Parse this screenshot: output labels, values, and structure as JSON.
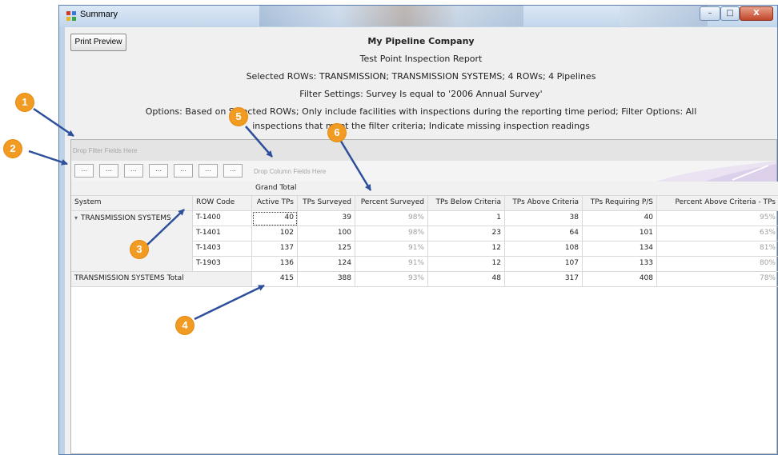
{
  "window": {
    "title": "Summary"
  },
  "controls": {
    "minimize": "–",
    "maximize": "□",
    "close": "X"
  },
  "toolbar": {
    "print_preview": "Print Preview"
  },
  "report": {
    "company": "My Pipeline Company",
    "title": "Test Point Inspection Report",
    "selected": "Selected ROWs: TRANSMISSION; TRANSMISSION SYSTEMS; 4 ROWs; 4 Pipelines",
    "filter": "Filter Settings: Survey Is equal to '2006 Annual Survey'",
    "options_line1": "Options: Based on Selected ROWs; Only include facilities with inspections during the reporting time period; Filter Options: All",
    "options_line2": "inspections that meet the filter criteria; Indicate missing inspection readings"
  },
  "pivot": {
    "filter_drop": "Drop Filter Fields Here",
    "column_drop": "Drop Column Fields Here",
    "field_buttons": [
      "...",
      "...",
      "...",
      "...",
      "...",
      "...",
      "..."
    ],
    "grand_total": "Grand Total",
    "row_headers": [
      "System",
      "ROW Code"
    ],
    "columns": [
      "Active TPs",
      "TPs Surveyed",
      "Percent Surveyed",
      "TPs Below Criteria",
      "TPs Above Criteria",
      "TPs Requiring P/S",
      "Percent Above Criteria - TPs"
    ],
    "system": "TRANSMISSION SYSTEMS",
    "system_expander": "▾",
    "rows": [
      {
        "code": "T-1400",
        "values": [
          "40",
          "39",
          "98%",
          "1",
          "38",
          "40",
          "95%"
        ]
      },
      {
        "code": "T-1401",
        "values": [
          "102",
          "100",
          "98%",
          "23",
          "64",
          "101",
          "63%"
        ]
      },
      {
        "code": "T-1403",
        "values": [
          "137",
          "125",
          "91%",
          "12",
          "108",
          "134",
          "81%"
        ]
      },
      {
        "code": "T-1903",
        "values": [
          "136",
          "124",
          "91%",
          "12",
          "107",
          "133",
          "80%"
        ]
      }
    ],
    "total": {
      "label": "TRANSMISSION SYSTEMS Total",
      "values": [
        "415",
        "388",
        "93%",
        "48",
        "317",
        "408",
        "78%"
      ]
    }
  },
  "callouts": [
    "1",
    "2",
    "3",
    "4",
    "5",
    "6"
  ],
  "colors": {
    "callout": "#f29b22",
    "arrow": "#2e4f9c",
    "titlebar": "#c3d7ec"
  }
}
